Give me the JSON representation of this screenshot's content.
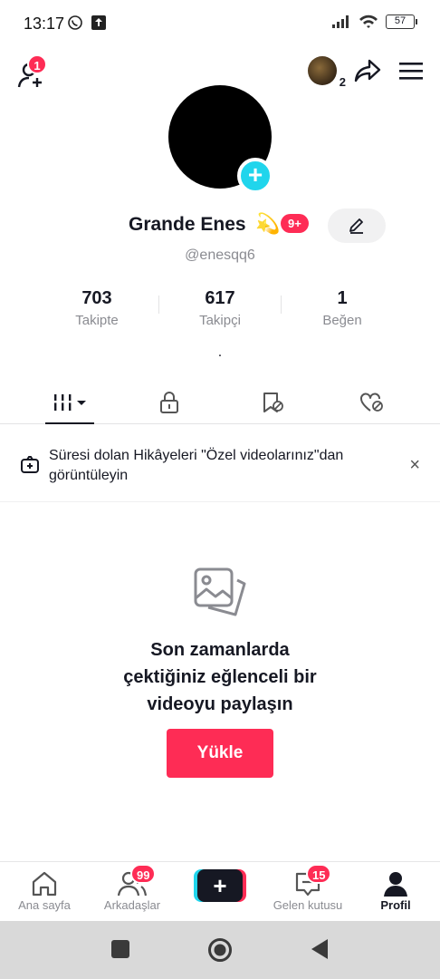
{
  "status_bar": {
    "time": "13:17",
    "battery": "57"
  },
  "top_bar": {
    "friend_requests_badge": "1",
    "stories_count": "2"
  },
  "profile": {
    "display_name": "Grande Enes",
    "name_emoji": "💫",
    "name_badge": "9+",
    "username": "@enesqq6",
    "bio": "."
  },
  "stats": [
    {
      "value": "703",
      "label": "Takipte"
    },
    {
      "value": "617",
      "label": "Takipçi"
    },
    {
      "value": "1",
      "label": "Beğen"
    }
  ],
  "banner": {
    "text": "Süresi dolan Hikâyeleri \"Özel videolarınız\"dan görüntüleyin",
    "close": "×"
  },
  "empty_state": {
    "line1": "Son zamanlarda",
    "line2": "çektiğiniz eğlenceli bir",
    "line3": "videoyu paylaşın",
    "button": "Yükle"
  },
  "bottom_nav": {
    "home": "Ana sayfa",
    "friends": "Arkadaşlar",
    "friends_badge": "99",
    "create": "+",
    "inbox": "Gelen kutusu",
    "inbox_badge": "15",
    "profile": "Profil"
  },
  "colors": {
    "accent": "#fe2c55",
    "cyan": "#20d5ec",
    "text": "#161823",
    "muted": "#8a8b91"
  }
}
